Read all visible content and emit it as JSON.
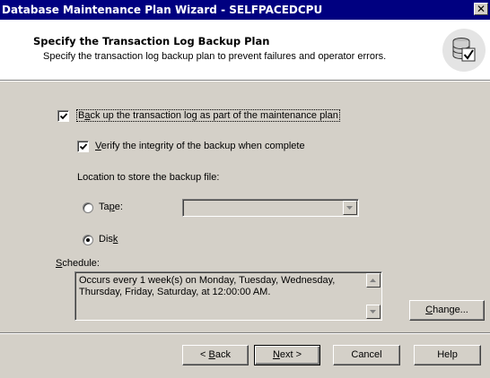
{
  "window": {
    "title": "Database Maintenance Plan Wizard - SELFPACEDCPU",
    "close_glyph": "✕"
  },
  "header": {
    "title": "Specify the Transaction Log Backup Plan",
    "subtitle": "Specify the transaction log backup plan to prevent failures and operator errors.",
    "icon": "database-check-icon"
  },
  "options": {
    "backup_log": {
      "label_prefix": "B",
      "label_mnemonic": "a",
      "label_rest": "ck up the transaction log as part of the maintenance plan",
      "checked": true
    },
    "verify": {
      "label_mnemonic": "V",
      "label_rest": "erify the integrity of the backup when complete",
      "checked": true
    },
    "location_label": "Location to store the backup file:",
    "tape": {
      "label_prefix": "Ta",
      "label_mnemonic": "p",
      "label_rest": "e:",
      "selected": false,
      "value": ""
    },
    "disk": {
      "label_prefix": "Dis",
      "label_mnemonic": "k",
      "label_rest": "",
      "selected": true
    }
  },
  "schedule": {
    "label_mnemonic": "S",
    "label_rest": "chedule:",
    "text": "Occurs every 1 week(s) on Monday, Tuesday, Wednesday, Thursday, Friday, Saturday, at 12:00:00 AM.",
    "change_mnemonic": "C",
    "change_rest": "hange..."
  },
  "buttons": {
    "back_prefix": "< ",
    "back_mnemonic": "B",
    "back_rest": "ack",
    "next_mnemonic": "N",
    "next_rest": "ext >",
    "cancel": "Cancel",
    "help": "Help"
  }
}
